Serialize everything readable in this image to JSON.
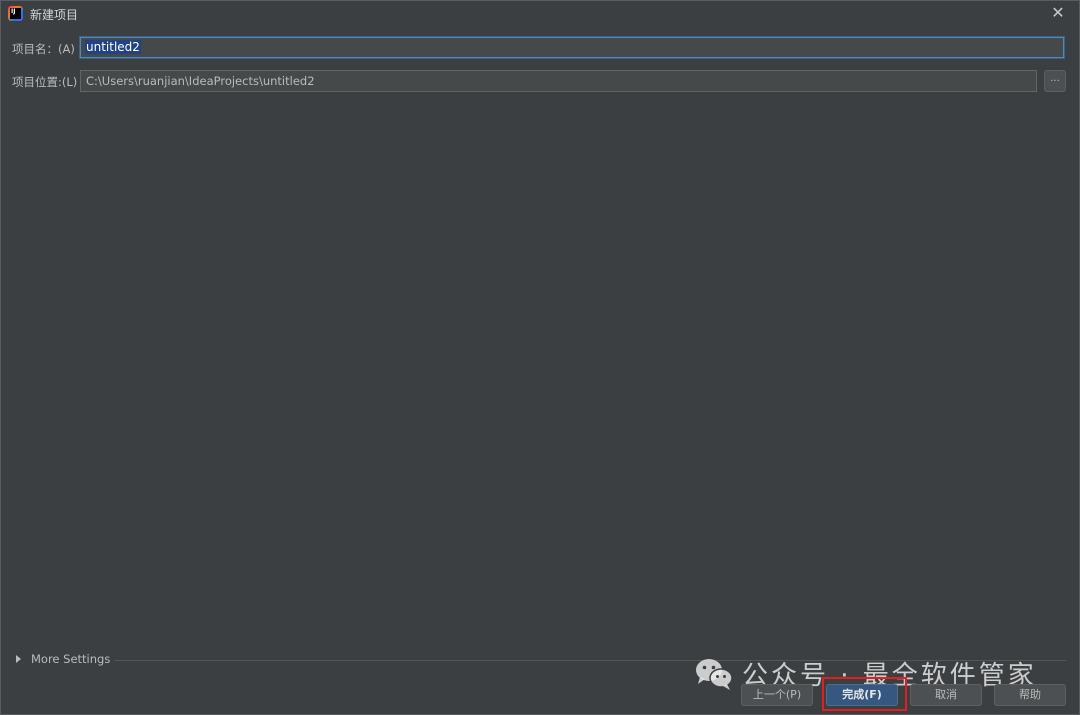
{
  "window": {
    "title": "新建项目",
    "app_icon": "intellij-idea-icon",
    "close_symbol": "✕"
  },
  "form": {
    "name_label": "项目名：(A)",
    "name_value": "untitled2",
    "location_label": "项目位置:(L)",
    "location_value": "C:\\Users\\ruanjian\\IdeaProjects\\untitled2",
    "browse_label": "..."
  },
  "more_settings": {
    "label": "More Settings"
  },
  "watermark": {
    "text": "公众号 · 最全软件管家",
    "icon": "wechat-icon"
  },
  "buttons": {
    "previous": "上一个(P)",
    "finish": "完成(F)",
    "cancel": "取消",
    "help": "帮助"
  },
  "colors": {
    "background": "#3c3f41",
    "focus_border": "#4a88c7",
    "selection": "#214283",
    "primary_button": "#365880",
    "annotation_red": "#e02020"
  }
}
